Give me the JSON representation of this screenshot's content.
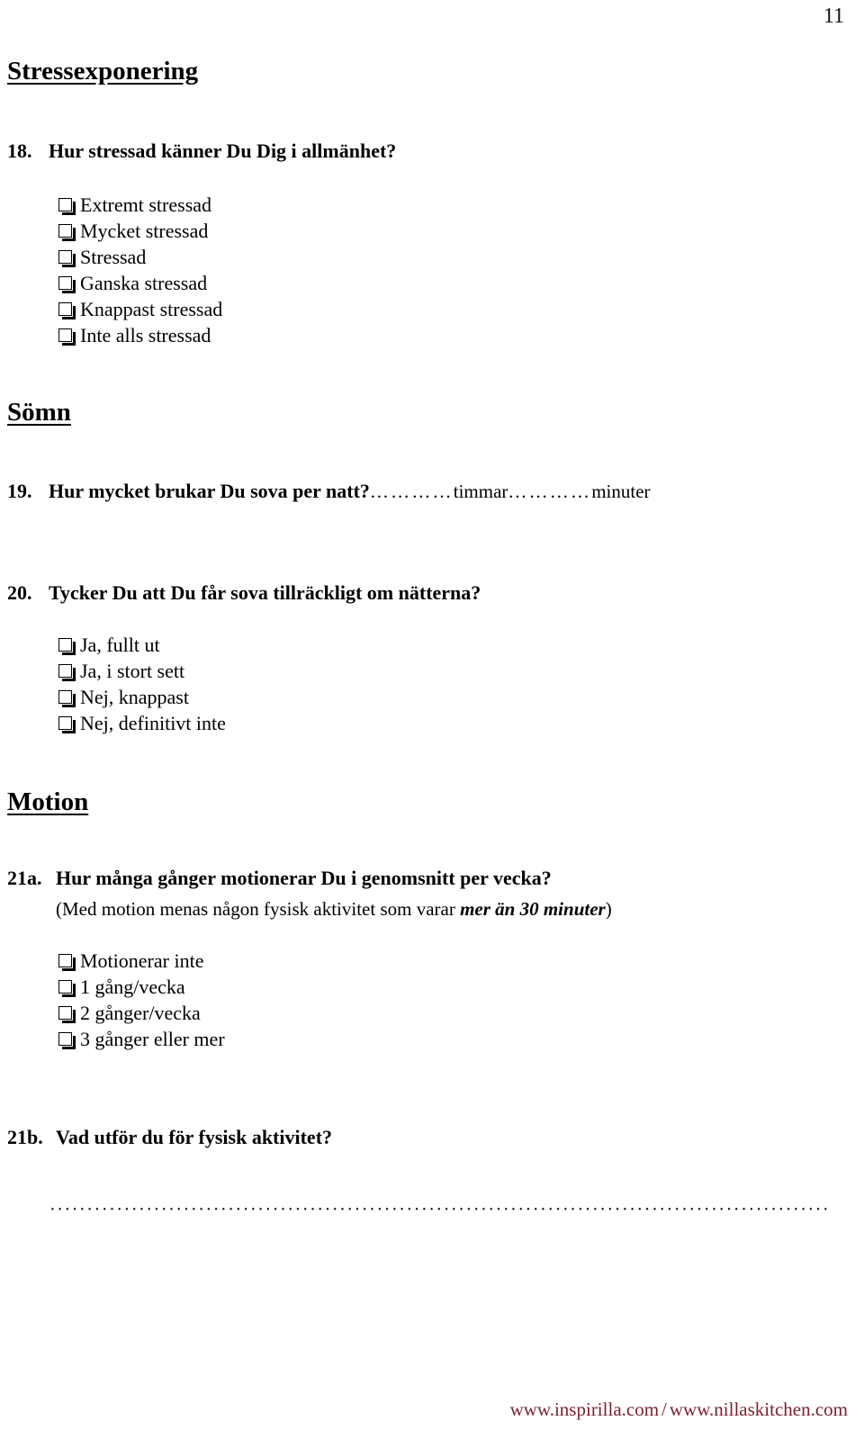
{
  "page": {
    "number": "11",
    "language": "sv"
  },
  "sections": {
    "stress": {
      "heading": "Stressexponering"
    },
    "sleep": {
      "heading": "Sömn"
    },
    "exercise": {
      "heading": "Motion"
    }
  },
  "questions": {
    "q18": {
      "number": "18.",
      "text": "Hur stressad känner Du Dig i allmänhet?",
      "options": [
        "Extremt stressad",
        "Mycket stressad",
        "Stressad",
        "Ganska stressad",
        "Knappast stressad",
        "Inte alls stressad"
      ]
    },
    "q19": {
      "number": "19.",
      "text": "Hur mycket brukar Du sova per natt?",
      "dots_first": "…………",
      "unit_hours": "timmar",
      "dots_second": "…………",
      "unit_minutes": "minuter"
    },
    "q20": {
      "number": "20.",
      "text": "Tycker Du att Du får sova tillräckligt om nätterna?",
      "options": [
        "Ja, fullt ut",
        "Ja, i stort sett",
        "Nej, knappast",
        "Nej, definitivt inte"
      ]
    },
    "q21a": {
      "number": "21a.",
      "text": "Hur många gånger motionerar Du i genomsnitt per vecka?",
      "subnote_prefix": "(Med motion menas någon fysisk aktivitet som varar ",
      "subnote_emphasis": "mer än 30 minuter",
      "subnote_suffix": ")",
      "options": [
        "Motionerar inte",
        "1 gång/vecka",
        "2 gånger/vecka",
        "3 gånger eller mer"
      ]
    },
    "q21b": {
      "number": "21b.",
      "text": "Vad utför du för fysisk aktivitet?",
      "answer_line": "·····················································································································································································································"
    }
  },
  "footer": {
    "link_left": "www.inspirilla.com",
    "separator": "/",
    "link_right": "www.nillaskitchen.com",
    "color": "#7B1F2B"
  },
  "icons": {
    "checkbox": "checkbox-empty"
  }
}
